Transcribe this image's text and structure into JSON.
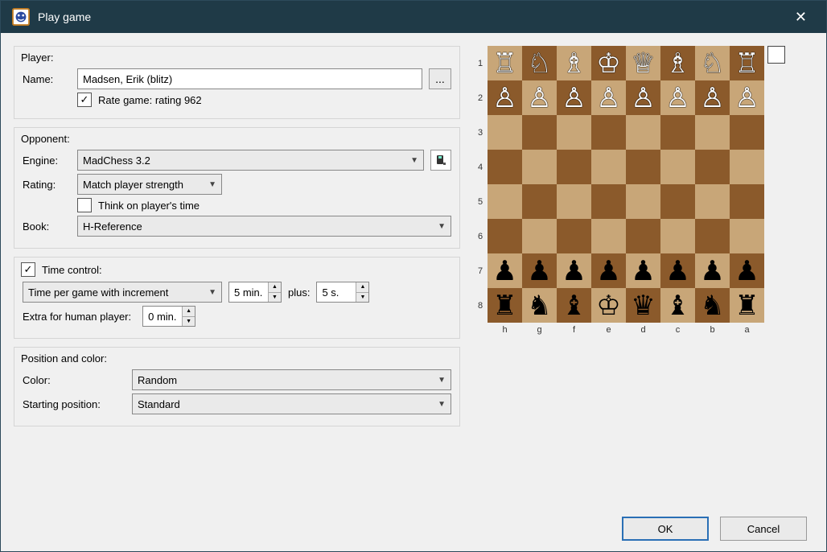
{
  "title": "Play game",
  "player": {
    "section_label": "Player:",
    "name_label": "Name:",
    "name_value": "Madsen, Erik (blitz)",
    "browse": "...",
    "rate_checked": true,
    "rate_label": "Rate game: rating 962"
  },
  "opponent": {
    "section_label": "Opponent:",
    "engine_label": "Engine:",
    "engine_value": "MadChess 3.2",
    "rating_label": "Rating:",
    "rating_value": "Match player strength",
    "think_checked": false,
    "think_label": "Think on player's time",
    "book_label": "Book:",
    "book_value": "H-Reference"
  },
  "time": {
    "section_checked": true,
    "section_label": "Time control:",
    "mode_value": "Time per game with increment",
    "time_value": "5 min.",
    "plus_label": "plus:",
    "increment_value": "5 s.",
    "extra_label": "Extra for human player:",
    "extra_value": "0 min."
  },
  "position": {
    "section_label": "Position and color:",
    "color_label": "Color:",
    "color_value": "Random",
    "start_label": "Starting position:",
    "start_value": "Standard"
  },
  "board": {
    "ranks": [
      "1",
      "2",
      "3",
      "4",
      "5",
      "6",
      "7",
      "8"
    ],
    "files": [
      "h",
      "g",
      "f",
      "e",
      "d",
      "c",
      "b",
      "a"
    ],
    "white_back": [
      "♖",
      "♘",
      "♗",
      "♔",
      "♕",
      "♗",
      "♘",
      "♖"
    ],
    "white_pawn": "♙",
    "black_pawn": "♟",
    "black_back": [
      "♜",
      "♞",
      "♝",
      "♔",
      "♛",
      "♝",
      "♞",
      "♜"
    ]
  },
  "footer": {
    "ok": "OK",
    "cancel": "Cancel"
  }
}
